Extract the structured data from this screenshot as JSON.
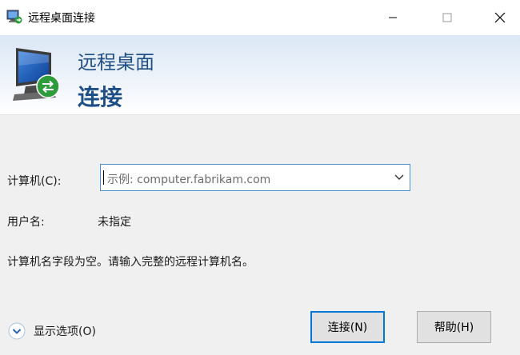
{
  "window": {
    "title": "远程桌面连接"
  },
  "banner": {
    "line1": "远程桌面",
    "line2": "连接"
  },
  "form": {
    "computer_label": "计算机(C):",
    "computer_placeholder": "示例: computer.fabrikam.com",
    "username_label": "用户名:",
    "username_value": "未指定",
    "hint": "计算机名字段为空。请输入完整的远程计算机名。"
  },
  "footer": {
    "options_label": "显示选项(O)",
    "connect_label": "连接(N)",
    "help_label": "帮助(H)"
  },
  "icons": {
    "title": "remote-desktop-icon",
    "banner": "remote-desktop-monitor-icon",
    "options": "chevron-down-circle-icon",
    "dropdown": "chevron-down-icon"
  },
  "colors": {
    "accent": "#0078d7",
    "banner_text": "#1e4f86"
  }
}
